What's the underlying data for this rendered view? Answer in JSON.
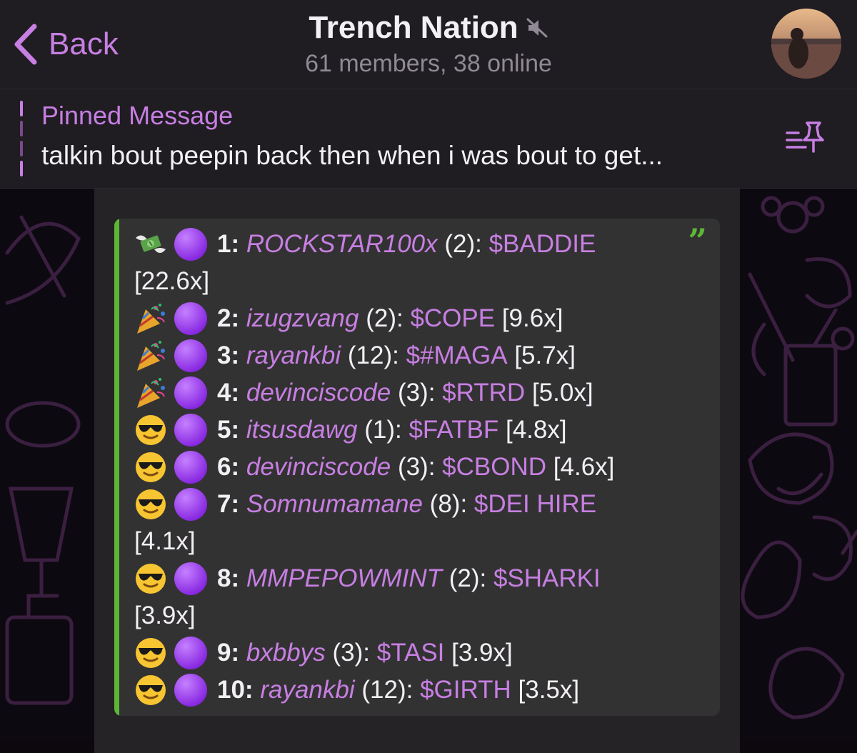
{
  "header": {
    "back_label": "Back",
    "title": "Trench Nation",
    "subtitle": "61 members, 38 online"
  },
  "pinned": {
    "title": "Pinned Message",
    "text": "talkin bout peepin back then when i was bout to get..."
  },
  "leaderboard": [
    {
      "emoji": "money-wings",
      "rank": "1:",
      "user": "ROCKSTAR100x",
      "count": "(2):",
      "ticker": "$BADDIE",
      "mult": "[22.6x]"
    },
    {
      "emoji": "party-popper",
      "rank": "2:",
      "user": "izugzvang",
      "count": "(2):",
      "ticker": "$COPE",
      "mult": "[9.6x]"
    },
    {
      "emoji": "party-popper",
      "rank": "3:",
      "user": "rayankbi",
      "count": "(12):",
      "ticker": "$#MAGA",
      "mult": "[5.7x]"
    },
    {
      "emoji": "party-popper",
      "rank": "4:",
      "user": "devinciscode",
      "count": "(3):",
      "ticker": "$RTRD",
      "mult": "[5.0x]"
    },
    {
      "emoji": "sunglasses",
      "rank": "5:",
      "user": "itsusdawg",
      "count": "(1):",
      "ticker": "$FATBF",
      "mult": "[4.8x]"
    },
    {
      "emoji": "sunglasses",
      "rank": "6:",
      "user": "devinciscode",
      "count": "(3):",
      "ticker": "$CBOND",
      "mult": "[4.6x]"
    },
    {
      "emoji": "sunglasses",
      "rank": "7:",
      "user": "Somnumamane",
      "count": "(8):",
      "ticker": "$DEI HIRE",
      "mult": "[4.1x]"
    },
    {
      "emoji": "sunglasses",
      "rank": "8:",
      "user": "MMPEPOWMINT",
      "count": "(2):",
      "ticker": "$SHARKI",
      "mult": "[3.9x]"
    },
    {
      "emoji": "sunglasses",
      "rank": "9:",
      "user": "bxbbys",
      "count": "(3):",
      "ticker": "$TASI",
      "mult": "[3.9x]"
    },
    {
      "emoji": "sunglasses",
      "rank": "10:",
      "user": "rayankbi",
      "count": "(12):",
      "ticker": "$GIRTH",
      "mult": "[3.5x]"
    }
  ],
  "colors": {
    "accent": "#c77fe2",
    "quote_bar": "#5bb734",
    "header_bg": "#1f1c22",
    "bubble_bg": "#252326",
    "quote_bg": "#333233"
  },
  "icons": [
    "chevron-left-icon",
    "mute-icon",
    "pinned-list-icon",
    "quote-icon",
    "purple-circle-icon"
  ]
}
